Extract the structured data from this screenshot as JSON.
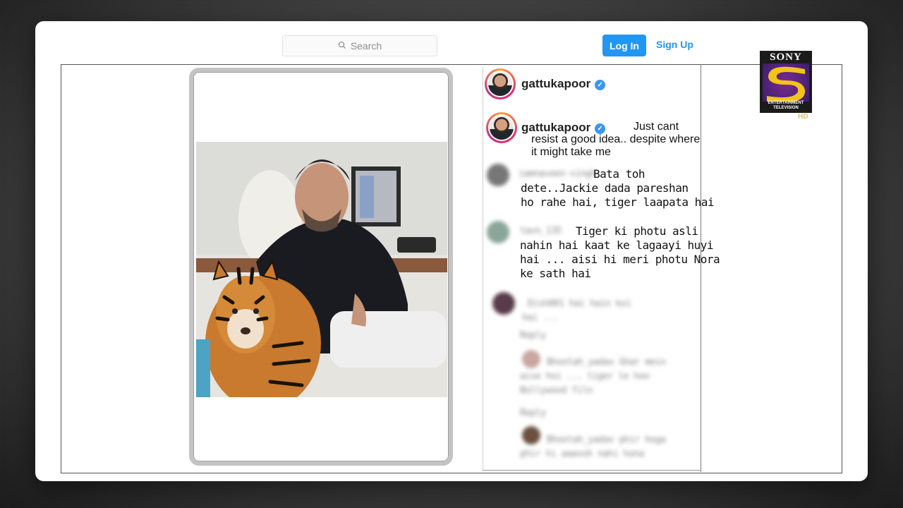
{
  "search": {
    "placeholder": "Search"
  },
  "auth": {
    "login": "Log In",
    "signup": "Sign Up"
  },
  "post": {
    "username": "gattukapoor",
    "caption_user": "gattukapoor",
    "caption": "Just cant resist a good idea.. despite where it might take me"
  },
  "comments": [
    {
      "user": "iamnaveen·singh",
      "text_lines": [
        "Bata toh",
        "dete..Jackie dada pareshan",
        "ho rahe hai, tiger laapata hai"
      ]
    },
    {
      "user": "tavn_135",
      "text_lines": [
        "Tiger ki photu asli",
        "nahin hai kaat ke lagaayi huyi",
        "hai ... aisi hi meri photu Nora",
        "ke sath hai"
      ]
    }
  ],
  "blurred_comments": [
    {
      "line1": "Dish001 hai hain koi",
      "line2": "hai ..."
    },
    {
      "line1": "Reply"
    },
    {
      "line1": "Bhootah_yadav   Ghar mein",
      "line2": "aise hoi ... tiger le hoo",
      "line3": "Bollywood filo"
    },
    {
      "line1": "Reply"
    },
    {
      "line1": "Bhootah_yadav  phir hoga",
      "line2": "phir hi aaavoh nahi hona"
    }
  ],
  "channel": {
    "name": "SONY",
    "sub": "ENTERTAINMENT TELEVISION",
    "hd": "HD"
  },
  "colors": {
    "accent": "#2196f3",
    "verified": "#3897f0"
  }
}
